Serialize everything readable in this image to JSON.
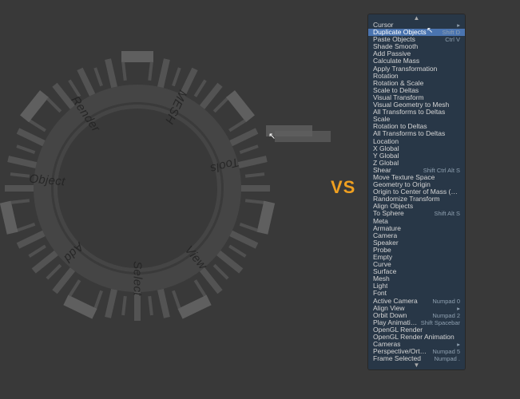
{
  "pie": {
    "labels": [
      "Render",
      "MESH",
      "Tools",
      "View",
      "Select",
      "Add",
      "Object"
    ]
  },
  "vs": "VS",
  "menu": {
    "scroll_up": "▲",
    "scroll_down": "▼",
    "items": [
      {
        "label": "Cursor",
        "submenu": true
      },
      {
        "label": "Duplicate Objects",
        "shortcut": "Shift D",
        "selected": true
      },
      {
        "label": "Paste Objects",
        "shortcut": "Ctrl V"
      },
      {
        "label": "Shade Smooth"
      },
      {
        "label": "Add Passive"
      },
      {
        "label": "Calculate Mass"
      },
      {
        "label": "Apply Transformation"
      },
      {
        "label": "Rotation"
      },
      {
        "label": "Rotation & Scale"
      },
      {
        "label": "Scale to Deltas"
      },
      {
        "label": "Visual Transform"
      },
      {
        "label": "Visual Geometry to Mesh"
      },
      {
        "label": "All Transforms to Deltas"
      },
      {
        "label": "Scale"
      },
      {
        "label": "Rotation to Deltas"
      },
      {
        "label": "All Transforms to Deltas"
      },
      {
        "label": "Location"
      },
      {
        "label": "X Global"
      },
      {
        "label": "Y Global"
      },
      {
        "label": "Z Global"
      },
      {
        "label": "Shear",
        "shortcut": "Shift Ctrl Alt S"
      },
      {
        "label": "Move Texture Space"
      },
      {
        "label": "Geometry to Origin"
      },
      {
        "label": "Origin to Center of Mass (Surface)"
      },
      {
        "label": "Randomize Transform"
      },
      {
        "label": "Align Objects"
      },
      {
        "label": "To Sphere",
        "shortcut": "Shift Alt S"
      },
      {
        "label": "Meta"
      },
      {
        "label": "Armature"
      },
      {
        "label": "Camera"
      },
      {
        "label": "Speaker"
      },
      {
        "label": "Probe"
      },
      {
        "label": "Empty"
      },
      {
        "label": "Curve"
      },
      {
        "label": "Surface"
      },
      {
        "label": "Mesh"
      },
      {
        "label": "Light"
      },
      {
        "label": "Font"
      },
      {
        "label": "Active Camera",
        "shortcut": "Numpad 0"
      },
      {
        "label": "Align View",
        "submenu": true
      },
      {
        "label": "Orbit Down",
        "shortcut": "Numpad 2"
      },
      {
        "label": "Play Animation",
        "shortcut": "Shift Spacebar"
      },
      {
        "label": "OpenGL Render"
      },
      {
        "label": "OpenGL Render Animation"
      },
      {
        "label": "Cameras",
        "submenu": true
      },
      {
        "label": "Perspective/Orthographic",
        "shortcut": "Numpad 5"
      },
      {
        "label": "Frame Selected",
        "shortcut": "Numpad ."
      }
    ]
  }
}
